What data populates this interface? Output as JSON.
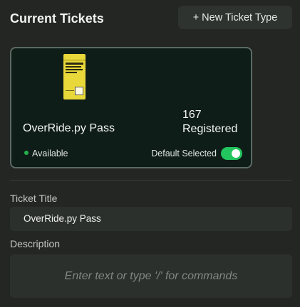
{
  "header": {
    "title": "Current Tickets",
    "new_button_label": "+ New Ticket Type"
  },
  "ticket_card": {
    "name": "OverRide.py Pass",
    "registered_count": "167",
    "registered_label": "Registered",
    "status": "Available",
    "status_color": "#23b04a",
    "default_label": "Default Selected",
    "default_selected": true,
    "toggle_color": "#22c55e",
    "image_icon": "ticket-image-icon"
  },
  "form": {
    "ticket_title_label": "Ticket Title",
    "ticket_title_value": "OverRide.py Pass",
    "description_label": "Description",
    "description_placeholder": "Enter text or type '/' for commands"
  }
}
